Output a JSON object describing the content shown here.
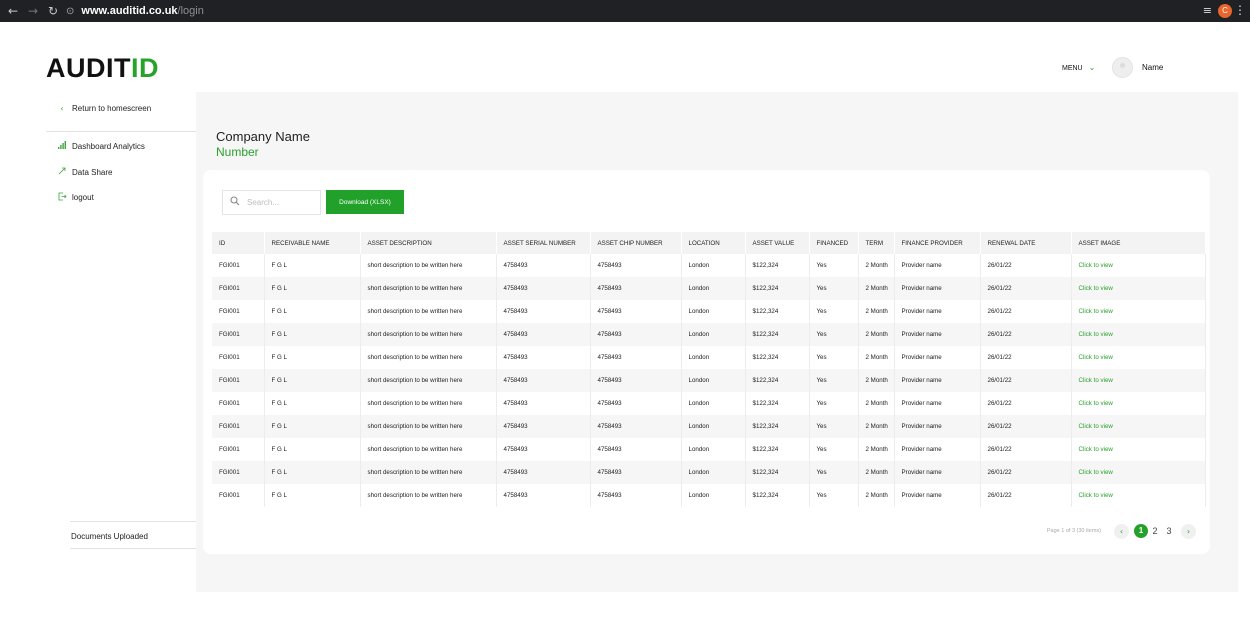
{
  "browser": {
    "url_host": "www.auditid.co.uk",
    "url_path": "/login",
    "profile_initial": "C"
  },
  "header": {
    "logo_black": "AUDIT",
    "logo_green": "ID",
    "menu_label": "MENU",
    "user_name": "Name"
  },
  "sidebar": {
    "return_label": "Return to homescreen",
    "items": [
      {
        "label": "Dashboard Analytics",
        "icon": "bar-chart-icon"
      },
      {
        "label": "Data Share",
        "icon": "share-icon"
      },
      {
        "label": "logout",
        "icon": "logout-icon"
      }
    ],
    "documents_label": "Documents Uploaded"
  },
  "main": {
    "company_name": "Company Name",
    "company_number": "Number",
    "search_placeholder": "Search...",
    "download_label": "Download (XLSX)"
  },
  "table": {
    "columns": [
      "ID",
      "RECEIVABLE NAME",
      "ASSET DESCRIPTION",
      "ASSET SERIAL NUMBER",
      "ASSET CHIP NUMBER",
      "LOCATION",
      "ASSET VALUE",
      "FINANCED",
      "TERM",
      "FINANCE PROVIDER",
      "RENEWAL DATE",
      "ASSET IMAGE"
    ],
    "rows": [
      [
        "FGI001",
        "F G L",
        "short description to be written here",
        "4758493",
        "4758493",
        "London",
        "$122,324",
        "Yes",
        "2 Month",
        "Provider name",
        "26/01/22",
        "Click to view"
      ],
      [
        "FGI001",
        "F G L",
        "short description to be written here",
        "4758493",
        "4758493",
        "London",
        "$122,324",
        "Yes",
        "2 Month",
        "Provider name",
        "26/01/22",
        "Click to view"
      ],
      [
        "FGI001",
        "F G L",
        "short description to be written here",
        "4758493",
        "4758493",
        "London",
        "$122,324",
        "Yes",
        "2 Month",
        "Provider name",
        "26/01/22",
        "Click to view"
      ],
      [
        "FGI001",
        "F G L",
        "short description to be written here",
        "4758493",
        "4758493",
        "London",
        "$122,324",
        "Yes",
        "2 Month",
        "Provider name",
        "26/01/22",
        "Click to view"
      ],
      [
        "FGI001",
        "F G L",
        "short description to be written here",
        "4758493",
        "4758493",
        "London",
        "$122,324",
        "Yes",
        "2 Month",
        "Provider name",
        "26/01/22",
        "Click to view"
      ],
      [
        "FGI001",
        "F G L",
        "short description to be written here",
        "4758493",
        "4758493",
        "London",
        "$122,324",
        "Yes",
        "2 Month",
        "Provider name",
        "26/01/22",
        "Click to view"
      ],
      [
        "FGI001",
        "F G L",
        "short description to be written here",
        "4758493",
        "4758493",
        "London",
        "$122,324",
        "Yes",
        "2 Month",
        "Provider name",
        "26/01/22",
        "Click to view"
      ],
      [
        "FGI001",
        "F G L",
        "short description to be written here",
        "4758493",
        "4758493",
        "London",
        "$122,324",
        "Yes",
        "2 Month",
        "Provider name",
        "26/01/22",
        "Click to view"
      ],
      [
        "FGI001",
        "F G L",
        "short description to be written here",
        "4758493",
        "4758493",
        "London",
        "$122,324",
        "Yes",
        "2 Month",
        "Provider name",
        "26/01/22",
        "Click to view"
      ],
      [
        "FGI001",
        "F G L",
        "short description to be written here",
        "4758493",
        "4758493",
        "London",
        "$122,324",
        "Yes",
        "2 Month",
        "Provider name",
        "26/01/22",
        "Click to view"
      ],
      [
        "FGI001",
        "F G L",
        "short description to be written here",
        "4758493",
        "4758493",
        "London",
        "$122,324",
        "Yes",
        "2 Month",
        "Provider name",
        "26/01/22",
        "Click to view"
      ]
    ]
  },
  "pagination": {
    "info": "Page 1 of 3 (30 items)",
    "pages": [
      "1",
      "2",
      "3"
    ],
    "active_page": "1"
  },
  "colors": {
    "brand_green": "#27a22a",
    "panel_bg": "#f6f6f6"
  }
}
